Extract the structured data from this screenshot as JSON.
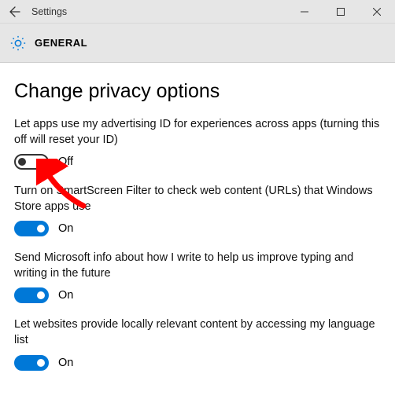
{
  "window": {
    "title": "Settings"
  },
  "category": {
    "label": "GENERAL"
  },
  "page": {
    "heading": "Change privacy options"
  },
  "settings": [
    {
      "desc": "Let apps use my advertising ID for experiences across apps (turning this off will reset your ID)",
      "state_label": "Off",
      "on": false
    },
    {
      "desc": "Turn on SmartScreen Filter to check web content (URLs) that Windows Store apps use",
      "state_label": "On",
      "on": true
    },
    {
      "desc": "Send Microsoft info about how I write to help us improve typing and writing in the future",
      "state_label": "On",
      "on": true
    },
    {
      "desc": "Let websites provide locally relevant content by accessing my language list",
      "state_label": "On",
      "on": true
    }
  ],
  "annotation": {
    "type": "arrow",
    "color": "#ff0000",
    "points_to": "advertising-id-toggle"
  }
}
